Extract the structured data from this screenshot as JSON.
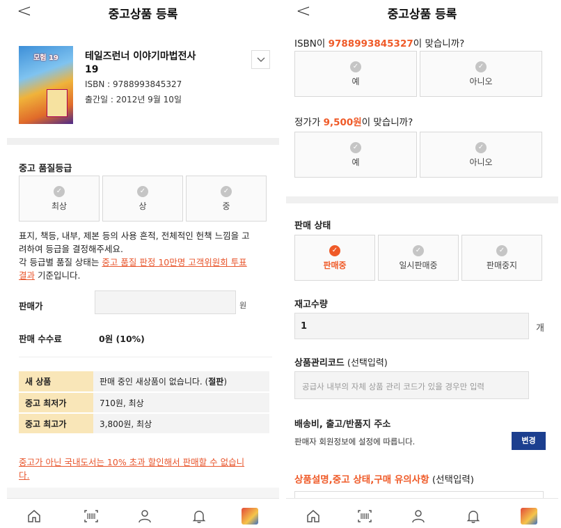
{
  "left": {
    "header": {
      "back": "<",
      "title": "중고상품 등록"
    },
    "book": {
      "cover_text": "모험 19",
      "title_line1": "테일즈런너 이야기마법전사",
      "title_line2": "19",
      "isbn": "ISBN : 9788993845327",
      "pubdate": "출간일 : 2012년 9월 10일"
    },
    "grade": {
      "label": "중고 품질등급",
      "options": [
        "최상",
        "상",
        "중"
      ],
      "desc1": "표지, 책등, 내부, 제본 등의 사용 흔적, 전체적인 헌책 느낌을 고",
      "desc2": "려하여 등급을 결정해주세요.",
      "desc3_pre": "각 등급별 품질 상태는 ",
      "desc3_link": "중고 품질 판정 10만명 고객위원회 투표",
      "desc4_link": "결과",
      "desc4_post": " 기준입니다."
    },
    "price": {
      "label": "판매가",
      "unit": "원",
      "value": ""
    },
    "fee": {
      "label": "판매 수수료",
      "value": "0원 (10%)"
    },
    "table": [
      {
        "key": "새 상품",
        "value": "판매 중인 새상품이 없습니다. (",
        "bold": "절판",
        "tail": ")"
      },
      {
        "key": "중고 최저가",
        "value": "710원, 최상",
        "bold": "",
        "tail": ""
      },
      {
        "key": "중고 최고가",
        "value": "3,800원, 최상",
        "bold": "",
        "tail": ""
      }
    ],
    "warning1": "중고가 아닌 국내도서는 10% 초과 할인해서 판매할 수 없습니",
    "warning2": "다."
  },
  "right": {
    "header": {
      "back": "<",
      "title": "중고상품 등록"
    },
    "isbn_q": {
      "pre": "ISBN이 ",
      "value": "9788993845327",
      "post": "이 맞습니까?"
    },
    "isbn_opts": [
      "예",
      "아니오"
    ],
    "price_q": {
      "pre": "정가가 ",
      "value": "9,500원",
      "post": "이 맞습니까?"
    },
    "price_opts": [
      "예",
      "아니오"
    ],
    "status": {
      "label": "판매 상태",
      "options": [
        "판매중",
        "일시판매중",
        "판매중지"
      ],
      "selected": "판매중"
    },
    "stock": {
      "label": "재고수량",
      "value": "1",
      "unit": "개"
    },
    "code": {
      "label": "상품관리코드",
      "optional": " (선택입력)",
      "placeholder": "공급사 내부의 자체 상품 관리 코드가 있을 경우만 입력"
    },
    "shipping": {
      "label": "배송비, 출고/반품지 주소",
      "desc": "판매자 회원정보에 설정에 따릅니다.",
      "button": "변경"
    },
    "desc_section": {
      "label": "상품설명,중고 상태,구매 유의사항",
      "optional": " (선택입력)"
    }
  },
  "nav": [
    "home-icon",
    "barcode-icon",
    "person-icon",
    "bell-icon",
    "profile-thumb"
  ],
  "colors": {
    "accent": "#ef5a28",
    "navy": "#1c3f8f",
    "highlight": "#f9e6b8"
  }
}
